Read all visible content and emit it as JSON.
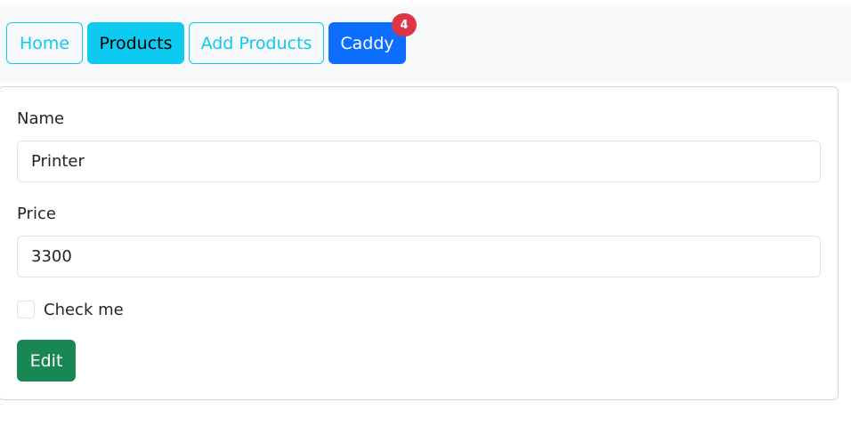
{
  "nav": {
    "home": "Home",
    "products": "Products",
    "add_products": "Add Products",
    "caddy": "Caddy",
    "caddy_count": "4"
  },
  "form": {
    "name_label": "Name",
    "name_value": "Printer",
    "price_label": "Price",
    "price_value": "3300",
    "check_label": "Check me",
    "check_checked": false,
    "edit_label": "Edit"
  },
  "colors": {
    "info": "#0dcaf0",
    "primary": "#0d6efd",
    "danger": "#dc3545",
    "success": "#198754",
    "navbar_bg": "#f8f9fa"
  }
}
